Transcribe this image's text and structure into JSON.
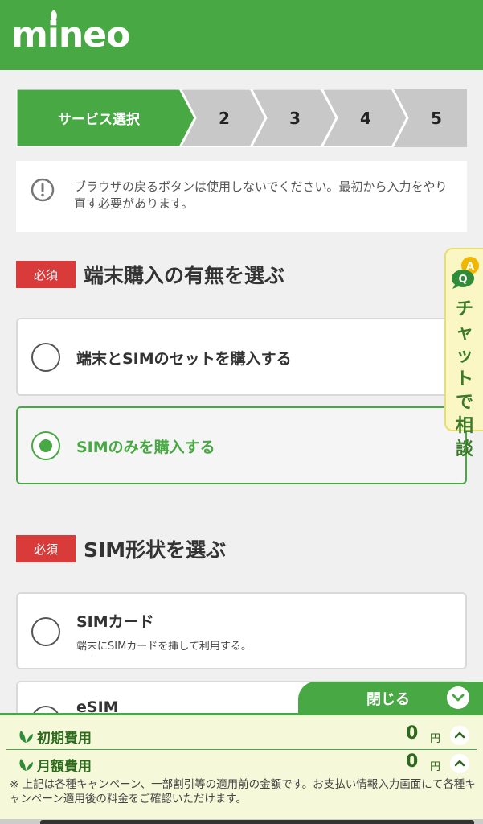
{
  "app": {
    "logo_text": "mineo"
  },
  "steps": [
    {
      "label": "サービス選択",
      "active": true
    },
    {
      "label": "2",
      "active": false
    },
    {
      "label": "3",
      "active": false
    },
    {
      "label": "4",
      "active": false
    },
    {
      "label": "5",
      "active": false
    }
  ],
  "notice": {
    "icon": "exclamation-circle-icon",
    "text": "ブラウザの戻るボタンは使用しないでください。最初から入力をやり直す必要があります。"
  },
  "section_device": {
    "badge": "必須",
    "title": "端末購入の有無を選ぶ",
    "options": [
      {
        "label": "端末とSIMのセットを購入する",
        "selected": false
      },
      {
        "label": "SIMのみを購入する",
        "selected": true
      }
    ]
  },
  "section_sim": {
    "badge": "必須",
    "title": "SIM形状を選ぶ",
    "options": [
      {
        "label": "SIMカード",
        "sub": "端末にSIMカードを挿して利用する。",
        "selected": false
      },
      {
        "label": "eSIM",
        "selected": false
      }
    ]
  },
  "chat": {
    "label": "チャットで相談",
    "icon": "chat-qa-icon"
  },
  "fees": {
    "close_label": "閉じる",
    "rows": [
      {
        "label": "初期費用",
        "value": "0",
        "unit": "円"
      },
      {
        "label": "月額費用",
        "value": "0",
        "unit": "円"
      }
    ],
    "note": "※ 上記は各種キャンペーン、一部割引等の適用前の金額です。お支払い情報入力画面にて各種キャンペーン適用後の料金をご確認いただけます。"
  },
  "colors": {
    "brand_green": "#48a843",
    "required_red": "#d93a3a",
    "chat_yellow": "#fbf7c4"
  }
}
